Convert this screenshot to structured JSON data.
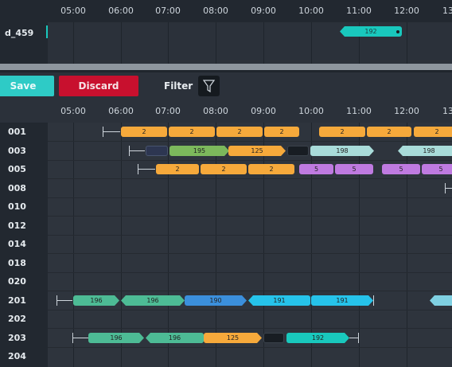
{
  "top": {
    "hours": [
      "05:00",
      "06:00",
      "07:00",
      "08:00",
      "09:00",
      "10:00",
      "11:00",
      "12:00",
      "13"
    ],
    "row_label": "d_459",
    "bar_label": "192"
  },
  "toolbar": {
    "save_label": "Save",
    "discard_label": "Discard",
    "filter_label": "Filter"
  },
  "grid": {
    "hours": [
      "05:00",
      "06:00",
      "07:00",
      "08:00",
      "09:00",
      "10:00",
      "11:00",
      "12:00",
      "13"
    ],
    "rows": [
      {
        "label": "001"
      },
      {
        "label": "003"
      },
      {
        "label": "005"
      },
      {
        "label": "008"
      },
      {
        "label": "010"
      },
      {
        "label": "012"
      },
      {
        "label": "014"
      },
      {
        "label": "018"
      },
      {
        "label": "020"
      },
      {
        "label": "201"
      },
      {
        "label": "202"
      },
      {
        "label": "203"
      },
      {
        "label": "204"
      }
    ],
    "bars": {
      "r001": [
        "2",
        "2",
        "2",
        "2",
        "2",
        "2",
        "2"
      ],
      "r003": [
        "195",
        "125",
        "198",
        "198"
      ],
      "r005": [
        "2",
        "2",
        "2",
        "5",
        "5",
        "5",
        "5"
      ],
      "r201": [
        "196",
        "196",
        "190",
        "191",
        "191"
      ],
      "r203": [
        "196",
        "196",
        "125",
        "192"
      ]
    }
  },
  "colors": {
    "orange": "#f6a93b",
    "green": "#7cb85c",
    "teal": "#19c8bd",
    "lightteal": "#a9dcda",
    "purple": "#bf7ae0",
    "seagreen": "#4dbb95",
    "blue": "#3b8fdc",
    "cyan": "#26c3ea",
    "red": "#c8102e",
    "save": "#2ecbc6"
  }
}
